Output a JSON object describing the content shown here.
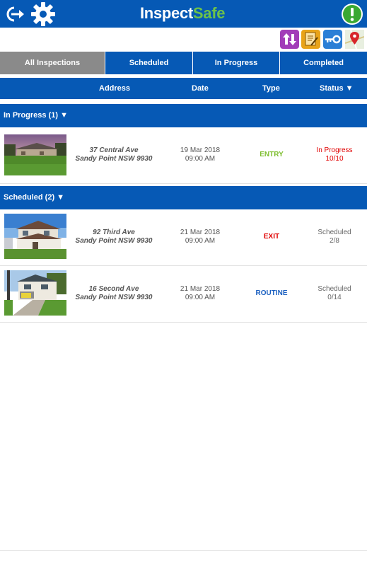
{
  "header": {
    "logo_part1": "Inspect",
    "logo_part2": "Safe"
  },
  "tabs": [
    "All Inspections",
    "Scheduled",
    "In Progress",
    "Completed"
  ],
  "columns": {
    "address": "Address",
    "date": "Date",
    "type": "Type",
    "status": "Status ▼"
  },
  "groups": {
    "in_progress": "In Progress (1) ▼",
    "scheduled": "Scheduled (2) ▼"
  },
  "rows": [
    {
      "street": "37 Central Ave",
      "suburb": "Sandy Point NSW 9930",
      "date": "19 Mar 2018",
      "time": "09:00 AM",
      "type": "ENTRY",
      "status": "In Progress",
      "progress": "10/10"
    },
    {
      "street": "92 Third Ave",
      "suburb": "Sandy Point NSW 9930",
      "date": "21 Mar 2018",
      "time": "09:00 AM",
      "type": "EXIT",
      "status": "Scheduled",
      "progress": "2/8"
    },
    {
      "street": "16 Second Ave",
      "suburb": "Sandy Point NSW 9930",
      "date": "21 Mar 2018",
      "time": "09:00 AM",
      "type": "ROUTINE",
      "status": "Scheduled",
      "progress": "0/14"
    }
  ],
  "colors": {
    "primary": "#0659b5",
    "active_tab": "#8a8a8a",
    "entry": "#7cbd2c",
    "exit": "#e00000",
    "routine": "#1a5fc0",
    "in_progress_status": "#e00000",
    "scheduled_status": "#666666"
  },
  "icons": [
    "logout-icon",
    "gear-icon",
    "alert-icon",
    "sync-icon",
    "notes-icon",
    "key-icon",
    "map-pin-icon"
  ]
}
